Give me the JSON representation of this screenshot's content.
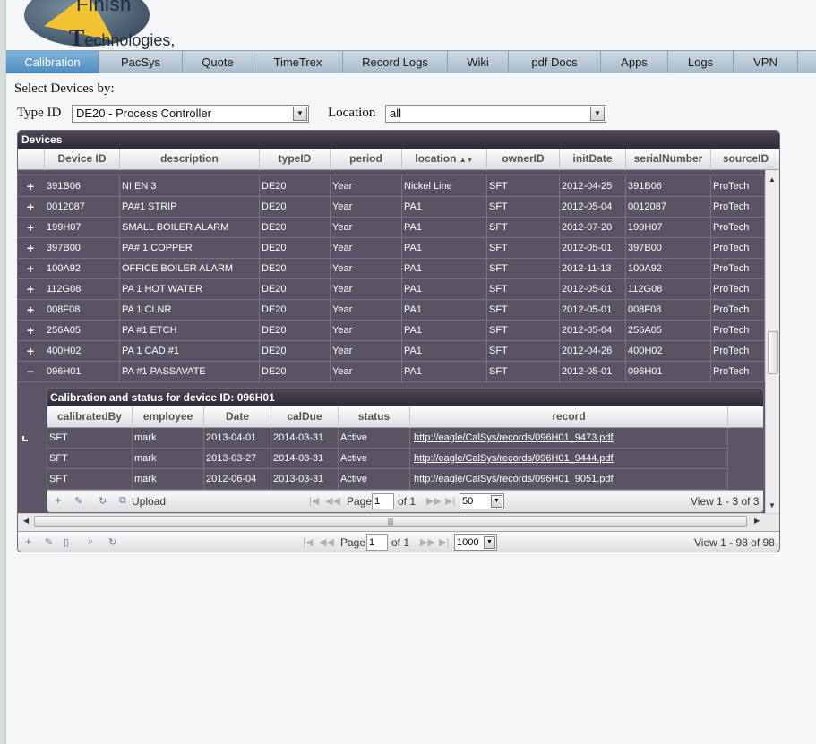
{
  "logo": {
    "text_top": "Finish",
    "text_bottom_initial": "T",
    "text_bottom_rest": "echnologies, inc."
  },
  "nav": {
    "tabs": [
      {
        "label": "Calibration",
        "active": true
      },
      {
        "label": "PacSys"
      },
      {
        "label": "Quote"
      },
      {
        "label": "TimeTrex"
      },
      {
        "label": "Record Logs"
      },
      {
        "label": "Wiki"
      },
      {
        "label": "pdf Docs"
      },
      {
        "label": "Apps"
      },
      {
        "label": "Logs"
      },
      {
        "label": "VPN"
      }
    ]
  },
  "filters": {
    "title": "Select Devices by:",
    "type_label": "Type ID",
    "type_value": "DE20 - Process Controller",
    "location_label": "Location",
    "location_value": "all"
  },
  "devices_grid": {
    "caption": "Devices",
    "columns": [
      "Device ID",
      "description",
      "typeID",
      "period",
      "location",
      "ownerID",
      "initDate",
      "serialNumber",
      "sourceID"
    ],
    "sorted_column": "location",
    "rows": [
      {
        "expand": "+",
        "cells": [
          "391B06",
          "NI EN 3",
          "DE20",
          "Year",
          "Nickel Line",
          "SFT",
          "2012-04-25",
          "391B06",
          "ProTech"
        ]
      },
      {
        "expand": "+",
        "cells": [
          "0012087",
          "PA#1 STRIP",
          "DE20",
          "Year",
          "PA1",
          "SFT",
          "2012-05-04",
          "0012087",
          "ProTech"
        ]
      },
      {
        "expand": "+",
        "cells": [
          "199H07",
          "SMALL BOILER ALARM",
          "DE20",
          "Year",
          "PA1",
          "SFT",
          "2012-07-20",
          "199H07",
          "ProTech"
        ]
      },
      {
        "expand": "+",
        "cells": [
          "397B00",
          "PA# 1 COPPER",
          "DE20",
          "Year",
          "PA1",
          "SFT",
          "2012-05-01",
          "397B00",
          "ProTech"
        ]
      },
      {
        "expand": "+",
        "cells": [
          "100A92",
          "OFFICE BOILER ALARM",
          "DE20",
          "Year",
          "PA1",
          "SFT",
          "2012-11-13",
          "100A92",
          "ProTech"
        ]
      },
      {
        "expand": "+",
        "cells": [
          "112G08",
          "PA 1  HOT WATER",
          "DE20",
          "Year",
          "PA1",
          "SFT",
          "2012-05-01",
          "112G08",
          "ProTech"
        ]
      },
      {
        "expand": "+",
        "cells": [
          "008F08",
          "PA 1 CLNR",
          "DE20",
          "Year",
          "PA1",
          "SFT",
          "2012-05-01",
          "008F08",
          "ProTech"
        ]
      },
      {
        "expand": "+",
        "cells": [
          "256A05",
          "PA #1 ETCH",
          "DE20",
          "Year",
          "PA1",
          "SFT",
          "2012-05-04",
          "256A05",
          "ProTech"
        ]
      },
      {
        "expand": "+",
        "cells": [
          "400H02",
          "PA 1 CAD #1",
          "DE20",
          "Year",
          "PA1",
          "SFT",
          "2012-04-26",
          "400H02",
          "ProTech"
        ]
      },
      {
        "expand": "−",
        "cells": [
          "096H01",
          "PA #1 PASSAVATE",
          "DE20",
          "Year",
          "PA1",
          "SFT",
          "2012-05-01",
          "096H01",
          "ProTech"
        ]
      }
    ],
    "pager": {
      "page_label": "Page",
      "page_value": "1",
      "of_label": "of 1",
      "rows_per_page": "1000",
      "view_info": "View 1 - 98 of 98"
    }
  },
  "subgrid": {
    "caption": "Calibration and status for device ID: 096H01",
    "columns": [
      "calibratedBy",
      "employee",
      "Date",
      "calDue",
      "status",
      "record"
    ],
    "rows": [
      [
        "SFT",
        "mark",
        "2013-04-01",
        "2014-03-31",
        "Active",
        "http://eagle/CalSys/records/096H01_9473.pdf"
      ],
      [
        "SFT",
        "mark",
        "2013-03-27",
        "2014-03-31",
        "Active",
        "http://eagle/CalSys/records/096H01_9444.pdf"
      ],
      [
        "SFT",
        "mark",
        "2012-06-04",
        "2013-03-31",
        "Active",
        "http://eagle/CalSys/records/096H01_9051.pdf"
      ]
    ],
    "pager": {
      "upload_label": "Upload",
      "page_label": "Page",
      "page_value": "1",
      "of_label": "of 1",
      "rows_per_page": "50",
      "view_info": "View 1 - 3 of 3"
    }
  }
}
